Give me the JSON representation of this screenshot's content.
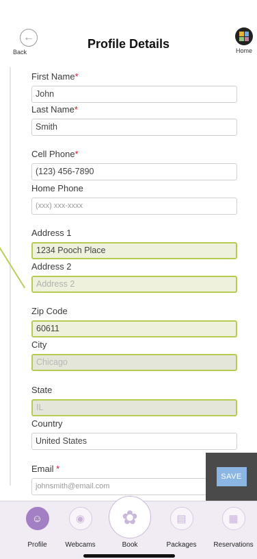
{
  "header": {
    "back_label": "Back",
    "title": "Profile Details",
    "home_label": "Home"
  },
  "fields": [
    {
      "label": "First Name",
      "required": true,
      "value": "John",
      "placeholder": ""
    },
    {
      "label": "Last Name",
      "required": true,
      "value": "Smith",
      "placeholder": ""
    },
    {
      "label": "Cell Phone",
      "required": true,
      "value": "(123) 456-7890",
      "placeholder": ""
    },
    {
      "label": "Home Phone",
      "required": false,
      "value": "",
      "placeholder": "(xxx) xxx-xxxx"
    },
    {
      "label": "Address 1",
      "required": false,
      "value": "1234 Pooch Place",
      "placeholder": ""
    },
    {
      "label": "Address 2",
      "required": false,
      "value": "",
      "placeholder": "Address 2"
    },
    {
      "label": "Zip Code",
      "required": false,
      "value": "60611",
      "placeholder": ""
    },
    {
      "label": "City",
      "required": false,
      "value": "Chicago",
      "placeholder": ""
    },
    {
      "label": "State",
      "required": false,
      "value": "IL",
      "placeholder": ""
    },
    {
      "label": "Country",
      "required": false,
      "value": "United States",
      "placeholder": ""
    },
    {
      "label": "Email ",
      "required": true,
      "value": "",
      "placeholder": "johnsmith@email.com"
    }
  ],
  "required_marker": "*",
  "save_label": "SAVE",
  "tabs": [
    {
      "label": "Profile",
      "icon": "person-icon"
    },
    {
      "label": "Webcams",
      "icon": "webcam-icon"
    },
    {
      "label": "Book",
      "icon": "paw-icon"
    },
    {
      "label": "Packages",
      "icon": "id-card-icon"
    },
    {
      "label": "Reservations",
      "icon": "calendar-icon"
    }
  ],
  "colors": {
    "accent_green": "#b5cc52",
    "tab_active": "#a37fc3",
    "required_red": "#d3142c",
    "save_blue": "#8bb6e3"
  }
}
